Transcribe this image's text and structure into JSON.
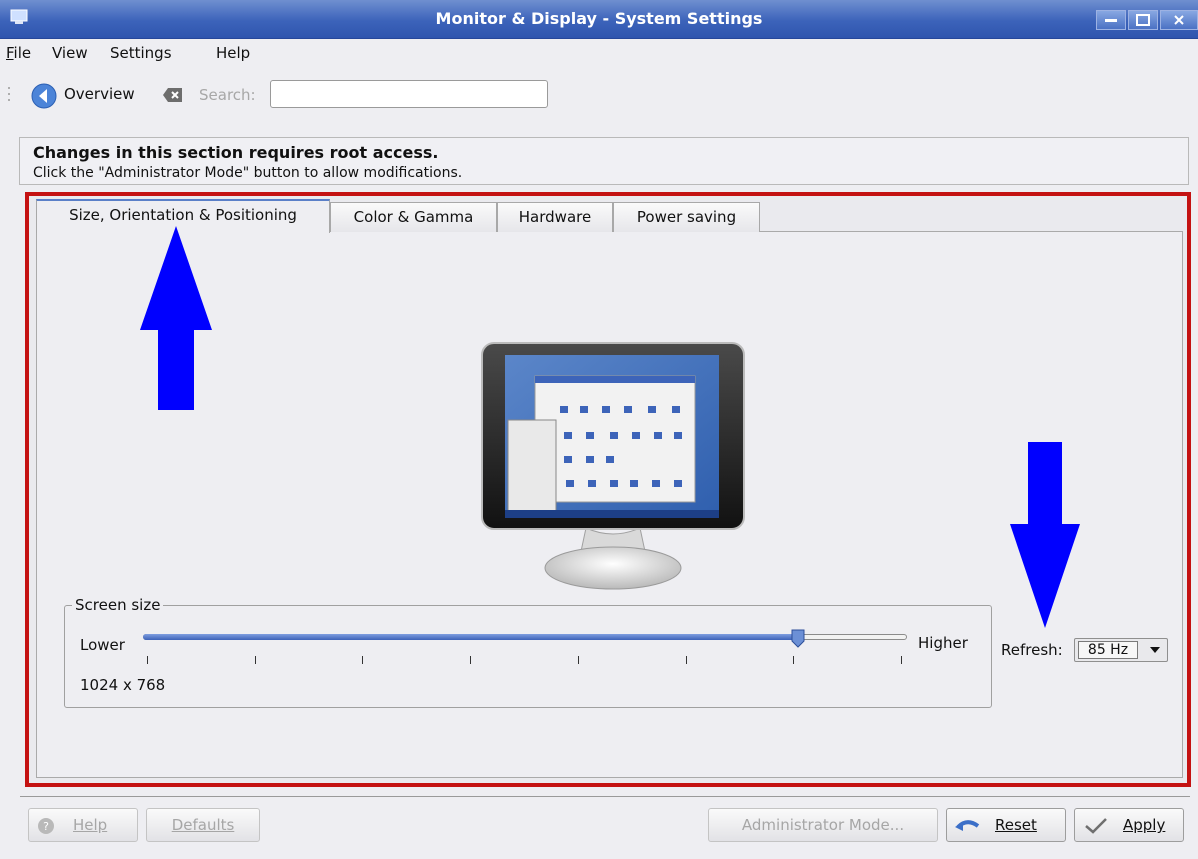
{
  "window": {
    "title": "Monitor & Display - System Settings",
    "titlebar_color": "#3c63ba"
  },
  "menu": {
    "items": [
      "File",
      "View",
      "Settings",
      "Help"
    ]
  },
  "toolbar": {
    "overview_label": "Overview",
    "search_label": "Search:",
    "search_value": ""
  },
  "info": {
    "heading": "Changes in this section requires root access.",
    "text": "Click the \"Administrator Mode\" button to allow modifications."
  },
  "tabs": [
    {
      "label": "Size, Orientation & Positioning",
      "active": true
    },
    {
      "label": "Color & Gamma",
      "active": false
    },
    {
      "label": "Hardware",
      "active": false
    },
    {
      "label": "Power saving",
      "active": false
    }
  ],
  "screen_size": {
    "group_title": "Screen size",
    "low_label": "Lower",
    "high_label": "Higher",
    "resolution": "1024 x 768",
    "slider_fraction": 0.857,
    "tick_count": 8
  },
  "refresh": {
    "label": "Refresh:",
    "value": "85 Hz"
  },
  "buttons": {
    "help": "Help",
    "defaults": "Defaults",
    "admin": "Administrator Mode...",
    "reset": "Reset",
    "apply": "Apply"
  },
  "annotations": {
    "arrow_color": "#0000ff",
    "frame_color": "#c41212"
  }
}
